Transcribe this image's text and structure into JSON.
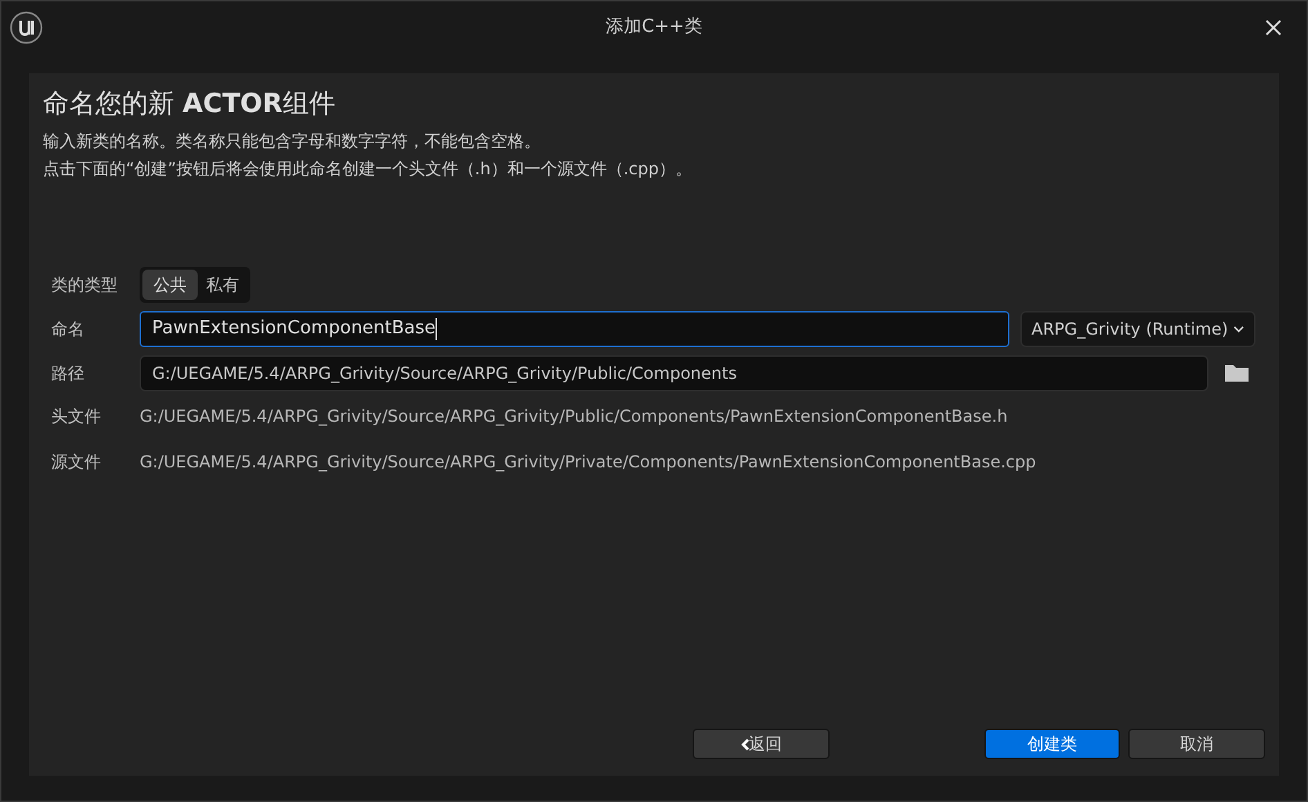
{
  "window": {
    "title": "添加C++类"
  },
  "heading": {
    "prefix": "命名您的新 ",
    "bold": "ACTOR",
    "suffix": "组件"
  },
  "description": [
    "输入新类的名称。类名称只能包含字母和数字字符，不能包含空格。",
    "点击下面的“创建”按钮后将会使用此命名创建一个头文件（.h）和一个源文件（.cpp）。"
  ],
  "class_type": {
    "label": "类的类型",
    "options": [
      {
        "label": "公共",
        "selected": true
      },
      {
        "label": "私有",
        "selected": false
      }
    ]
  },
  "name": {
    "label": "命名",
    "value": "PawnExtensionComponentBase",
    "module": "ARPG_Grivity (Runtime)"
  },
  "path": {
    "label": "路径",
    "value": "G:/UEGAME/5.4/ARPG_Grivity/Source/ARPG_Grivity/Public/Components"
  },
  "header_file": {
    "label": "头文件",
    "value": "G:/UEGAME/5.4/ARPG_Grivity/Source/ARPG_Grivity/Public/Components/PawnExtensionComponentBase.h"
  },
  "source_file": {
    "label": "源文件",
    "value": "G:/UEGAME/5.4/ARPG_Grivity/Source/ARPG_Grivity/Private/Components/PawnExtensionComponentBase.cpp"
  },
  "buttons": {
    "back": "返回",
    "create": "创建类",
    "cancel": "取消"
  }
}
